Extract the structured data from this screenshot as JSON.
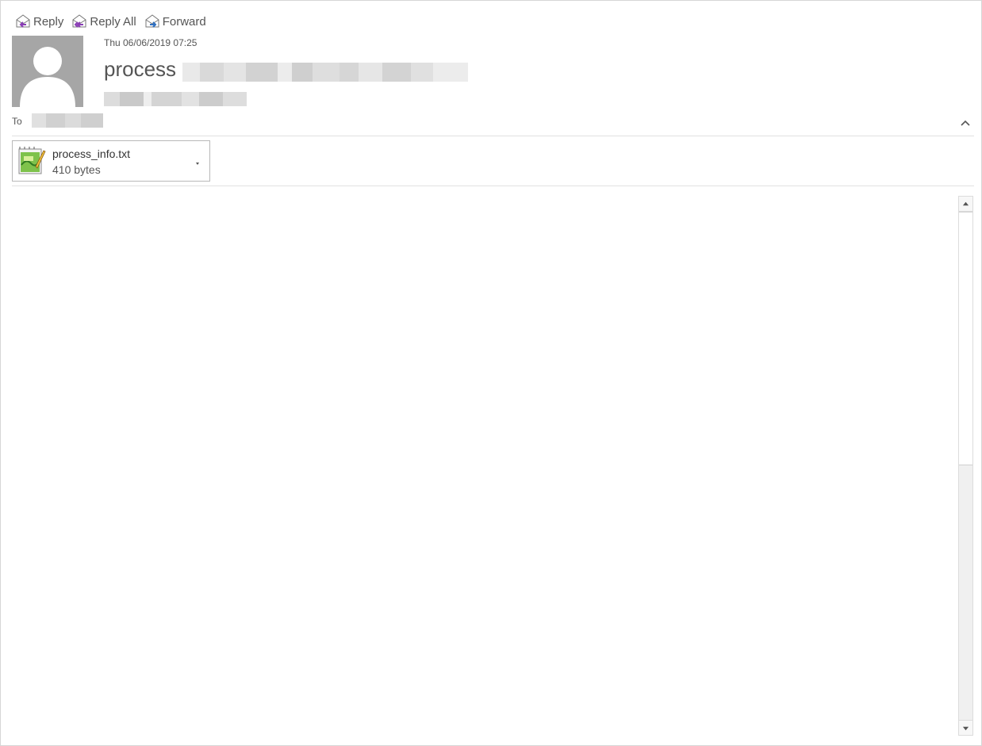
{
  "toolbar": {
    "reply_label": "Reply",
    "reply_all_label": "Reply All",
    "forward_label": "Forward"
  },
  "message": {
    "date": "Thu 06/06/2019 07:25",
    "subject": "process",
    "to_label": "To"
  },
  "attachment": {
    "name": "process_info.txt",
    "size": "410 bytes",
    "icon": "notepad-text-file-icon"
  },
  "colors": {
    "avatar_bg": "#a6a6a6",
    "reply_arrow": "#8a3db6",
    "forward_arrow": "#2f6fc0"
  }
}
